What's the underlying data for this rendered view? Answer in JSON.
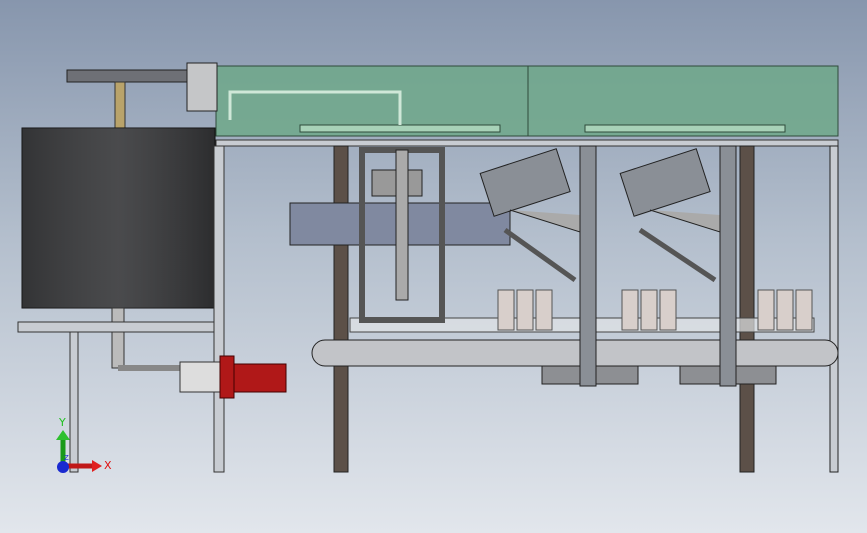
{
  "viewport": {
    "triad": {
      "x_label": "X",
      "y_label": "Y",
      "z_label": "Z"
    },
    "colors": {
      "enclosure": "#6fa88a",
      "tank": "#3e3f42",
      "frame": "#5c5048",
      "motor": "#b01818",
      "gearbox": "#8a8f96"
    }
  }
}
